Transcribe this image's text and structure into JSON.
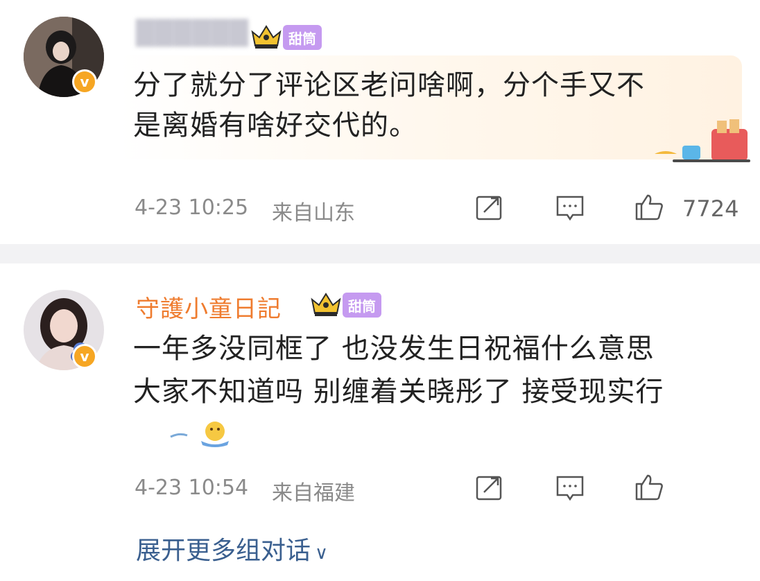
{
  "comments": [
    {
      "username": "██████",
      "tag": "甜筒",
      "text_line1": "分了就分了评论区老问啥啊，分个手又不",
      "text_line2": "是离婚有啥好交代的。",
      "time": "4-23 10:25",
      "location": "来自山东",
      "likes": "7724"
    },
    {
      "username": "守護小童日記",
      "tag": "甜筒",
      "text_line1": "一年多没同框了 也没发生日祝福什么意思",
      "text_line2": "大家不知道吗 别缠着关晓彤了 接受现实行",
      "time": "4-23 10:54",
      "location": "来自福建",
      "likes": ""
    }
  ],
  "expand_label": "展开更多组对话",
  "colors": {
    "username": "#ef7c2f",
    "tag_bg": "#c59af0",
    "link": "#3a5f8f",
    "meta": "#8a8a8a",
    "divider": "#f2f2f4"
  }
}
